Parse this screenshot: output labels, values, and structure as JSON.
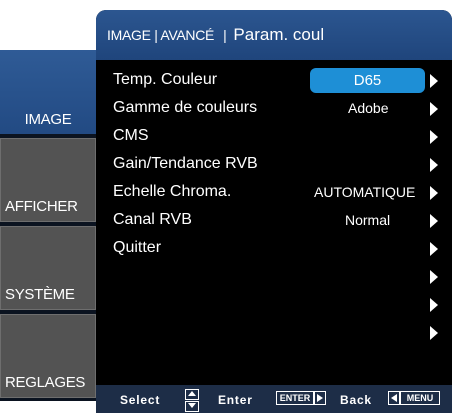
{
  "header": {
    "crumb": "IMAGE | AVANCÉ",
    "separator": "|",
    "title": "Param. coul"
  },
  "tabs": [
    {
      "label": "IMAGE",
      "active": true
    },
    {
      "label": "AFFICHER",
      "active": false
    },
    {
      "label": "SYSTÈME",
      "active": false
    },
    {
      "label": "REGLAGES",
      "active": false
    }
  ],
  "rows": [
    {
      "label": "Temp. Couleur",
      "value": "D65"
    },
    {
      "label": "Gamme de couleurs",
      "value": "Adobe"
    },
    {
      "label": "CMS",
      "value": ""
    },
    {
      "label": "Gain/Tendance RVB",
      "value": ""
    },
    {
      "label": "Echelle Chroma.",
      "value": "AUTOMATIQUE"
    },
    {
      "label": "Canal RVB",
      "value": "Normal"
    },
    {
      "label": "Quitter",
      "value": ""
    }
  ],
  "footer": {
    "select": "Select",
    "enter": "Enter",
    "enter_key": "ENTER",
    "back": "Back",
    "menu_key": "MENU"
  },
  "colors": {
    "header_blue": "#2c5690",
    "selected_value_bg": "#1e8fd6",
    "panel_bg": "#000000",
    "footer_bg": "#1d2d47"
  }
}
